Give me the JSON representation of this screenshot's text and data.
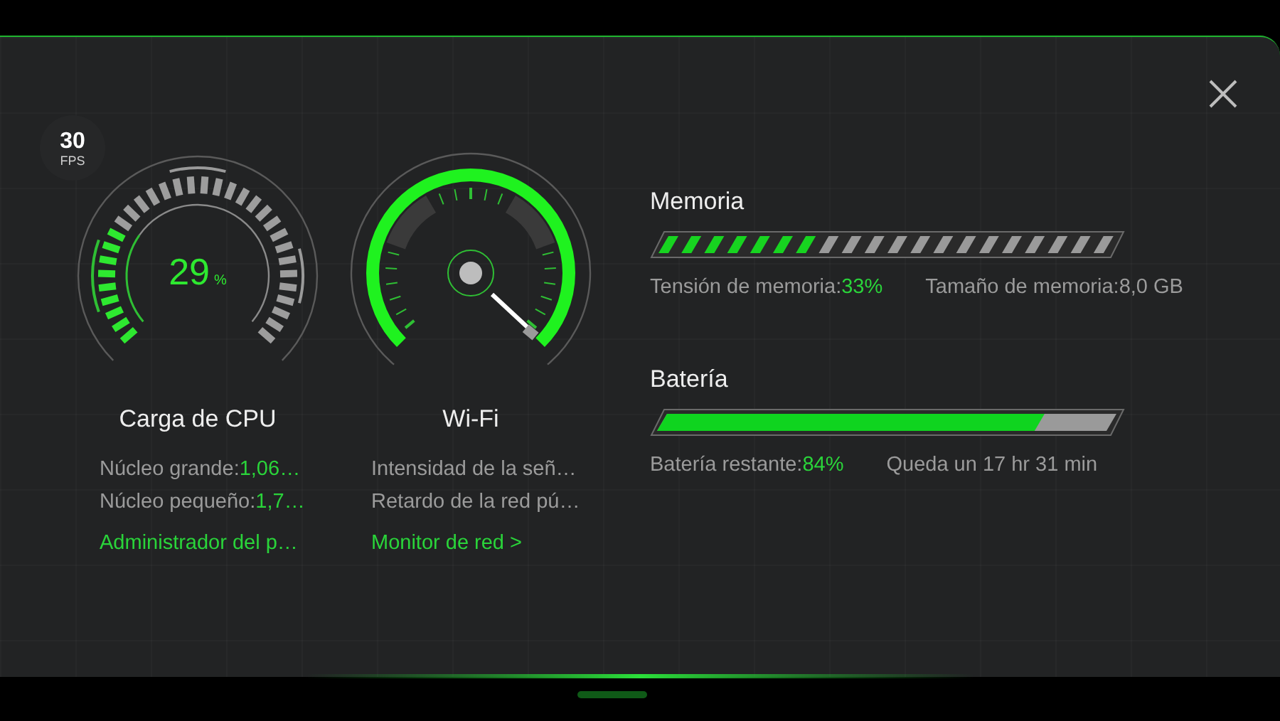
{
  "fps": {
    "value": "30",
    "unit": "FPS"
  },
  "cpu": {
    "title": "Carga de CPU",
    "reading": "29",
    "unit": "%",
    "level": 0.29,
    "stats": [
      {
        "label": "Núcleo grande:",
        "value": "1,06…"
      },
      {
        "label": "Núcleo pequeño:",
        "value": "1,7…"
      }
    ],
    "link": "Administrador del p…"
  },
  "wifi": {
    "title": "Wi-Fi",
    "stats": [
      {
        "label": "Intensidad de la señ…"
      },
      {
        "label": "Retardo de la red pú…"
      }
    ],
    "link": "Monitor de red >"
  },
  "memory": {
    "title": "Memoria",
    "level": 0.33,
    "stats": [
      {
        "label": "Tensión de memoria:",
        "value": "33%"
      },
      {
        "label": "Tamaño de memoria:8,0 GB"
      }
    ]
  },
  "battery": {
    "title": "Batería",
    "level": 0.84,
    "stats": [
      {
        "label": "Batería restante:",
        "value": "84%"
      },
      {
        "label": "Queda un 17 hr 31 min"
      }
    ]
  }
}
